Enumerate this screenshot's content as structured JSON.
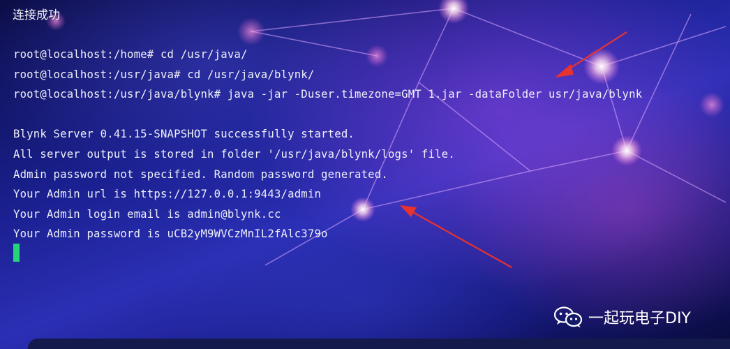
{
  "window": {
    "title": "连接成功"
  },
  "terminal": {
    "lines": [
      "root@localhost:/home# cd /usr/java/",
      "root@localhost:/usr/java# cd /usr/java/blynk/",
      "root@localhost:/usr/java/blynk# java -jar -Duser.timezone=GMT 1.jar -dataFolder usr/java/blynk",
      "",
      "Blynk Server 0.41.15-SNAPSHOT successfully started.",
      "All server output is stored in folder '/usr/java/blynk/logs' file.",
      "Admin password not specified. Random password generated.",
      "Your Admin url is https://127.0.0.1:9443/admin",
      "Your Admin login email is admin@blynk.cc",
      "Your Admin password is uCB2yM9WVCzMnIL2fAlc379o"
    ],
    "cursor_color": "#25d37a",
    "text_color": "#eef0f8"
  },
  "annotations": {
    "arrow_color": "#e8322e"
  },
  "watermark": {
    "icon": "wechat-icon",
    "text": "一起玩电子DIY"
  }
}
